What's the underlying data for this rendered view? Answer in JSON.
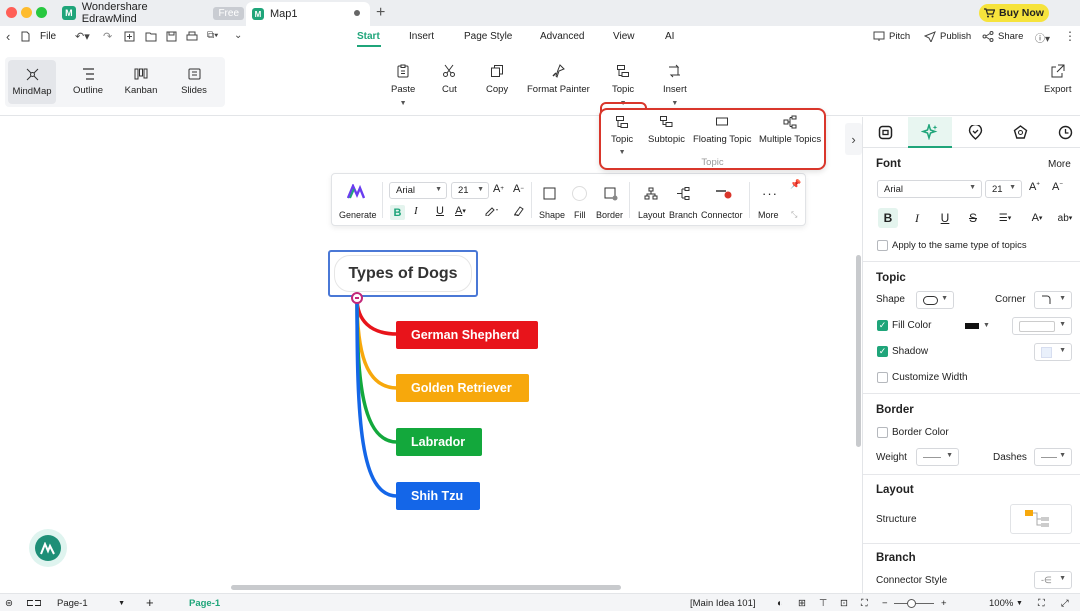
{
  "titlebar": {
    "app_name": "Wondershare EdrawMind",
    "free_badge": "Free",
    "doc_tab": "Map1",
    "buy_now": "Buy Now"
  },
  "menubar": {
    "file": "File",
    "tabs": [
      "Start",
      "Insert",
      "Page Style",
      "Advanced",
      "View",
      "AI"
    ],
    "pitch": "Pitch",
    "publish": "Publish",
    "share": "Share"
  },
  "ribbon": {
    "views": [
      "MindMap",
      "Outline",
      "Kanban",
      "Slides"
    ],
    "paste": "Paste",
    "cut": "Cut",
    "copy": "Copy",
    "format_painter": "Format Painter",
    "topic": "Topic",
    "insert": "Insert",
    "export": "Export"
  },
  "topic_dropdown": {
    "items": [
      "Topic",
      "Subtopic",
      "Floating Topic",
      "Multiple Topics"
    ],
    "caption": "Topic"
  },
  "floating_toolbar": {
    "generate": "Generate",
    "font": "Arial",
    "size": "21",
    "bold": "B",
    "italic": "I",
    "underline": "U",
    "shape": "Shape",
    "fill": "Fill",
    "border": "Border",
    "layout": "Layout",
    "branch": "Branch",
    "connector": "Connector",
    "more": "More"
  },
  "mindmap": {
    "root": "Types of Dogs",
    "subtopics": [
      {
        "label": "German Shepherd",
        "color": "#e8141b"
      },
      {
        "label": "Golden Retriever",
        "color": "#f7a80c"
      },
      {
        "label": "Labrador",
        "color": "#13a83c"
      },
      {
        "label": "Shih Tzu",
        "color": "#1466e8"
      }
    ]
  },
  "panel": {
    "font": {
      "title": "Font",
      "more": "More",
      "family": "Arial",
      "size": "21",
      "apply_same": "Apply to the same type of topics"
    },
    "topic": {
      "title": "Topic",
      "shape": "Shape",
      "corner": "Corner",
      "fill_color": "Fill Color",
      "shadow": "Shadow",
      "customize_width": "Customize Width"
    },
    "border": {
      "title": "Border",
      "border_color": "Border Color",
      "weight": "Weight",
      "dashes": "Dashes"
    },
    "layout": {
      "title": "Layout",
      "structure": "Structure"
    },
    "branch": {
      "title": "Branch",
      "connector_style": "Connector Style"
    }
  },
  "statusbar": {
    "page_select": "Page-1",
    "page_tab": "Page-1",
    "selection": "[Main Idea 101]",
    "zoom": "100%"
  },
  "colors": {
    "accent": "#1fa57a",
    "highlight": "#d9362b",
    "root_border": "#4a78d6"
  }
}
